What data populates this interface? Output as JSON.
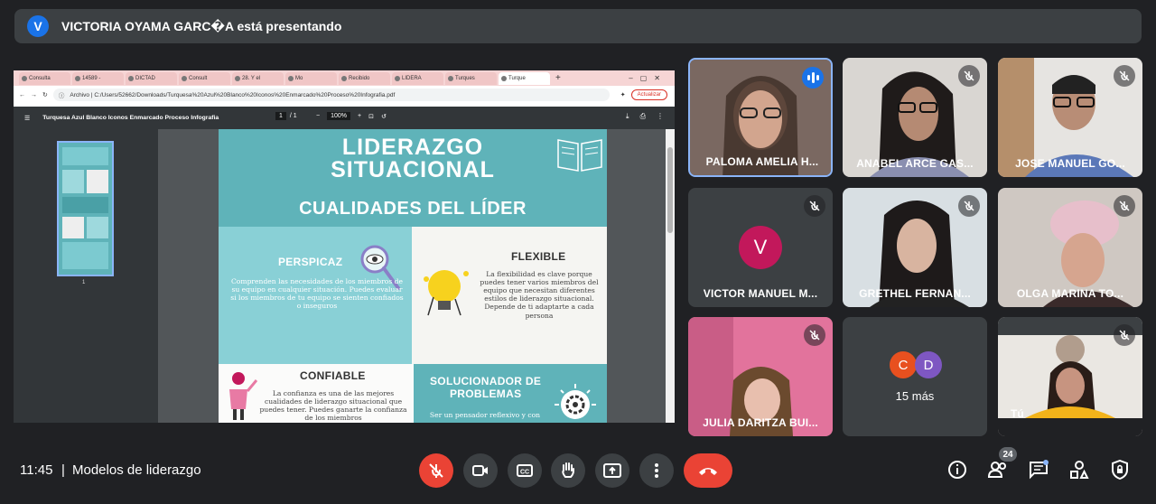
{
  "presenting": {
    "avatar_letter": "V",
    "text": "VICTORIA OYAMA GARC�A está presentando"
  },
  "browser": {
    "tabs": [
      "Consulta",
      "14589 -",
      "DICTAD",
      "Consult",
      "28. Y el",
      "Mo",
      "Recibido",
      "LIDERA",
      "Turques",
      "Turque"
    ],
    "url": "Archivo  |  C:/Users/52662/Downloads/Turquesa%20Azul%20Blanco%20Iconos%20Enmarcado%20Proceso%20Infografia.pdf",
    "update_label": "Actualizar"
  },
  "pdf": {
    "title": "Turquesa Azul Blanco Iconos Enmarcado Proceso Infografia",
    "page_current": "1",
    "page_total": "/ 1",
    "zoom": "100%",
    "thumb_page": "1"
  },
  "infographic": {
    "title_line1": "LIDERAZGO",
    "title_line2": "SITUACIONAL",
    "subtitle": "CUALIDADES DEL LÍDER",
    "perspicaz": {
      "title": "PERSPICAZ",
      "text": "Comprenden las necesidades de los miembros de su equipo en cualquier situación. Puedes evaluar si los miembros de tu equipo se sienten confiados o inseguros"
    },
    "flexible": {
      "title": "FLEXIBLE",
      "text": "La flexibilidad es clave porque puedes tener varios miembros del equipo que necesitan diferentes estilos de liderazgo situacional. Depende de ti adaptarte a cada persona"
    },
    "confiable": {
      "title": "CONFIABLE",
      "text": "La confianza es una de las mejores cualidades de liderazgo situacional que puedes tener. Puedes ganarte la confianza de los miembros"
    },
    "solucionador": {
      "title_line1": "SOLUCIONADOR DE",
      "title_line2": "PROBLEMAS",
      "text": "Ser un pensador reflexivo y con"
    }
  },
  "participants": [
    {
      "name": "PALOMA AMELIA H...",
      "state": "speaking"
    },
    {
      "name": "ANABEL ARCE GAS...",
      "state": "muted"
    },
    {
      "name": "JOSE MANUEL GO...",
      "state": "muted"
    },
    {
      "name": "VICTOR MANUEL M...",
      "state": "muted",
      "avatar_letter": "V",
      "avatar_color": "#c2185b"
    },
    {
      "name": "GRETHEL FERNAN...",
      "state": "muted"
    },
    {
      "name": "OLGA MARINA TO...",
      "state": "muted"
    },
    {
      "name": "JULIA DARITZA BUI...",
      "state": "muted"
    },
    {
      "name": "Tú",
      "state": "muted"
    }
  ],
  "more_tile": {
    "avatars": [
      "C",
      "D"
    ],
    "label": "15 más"
  },
  "bottom": {
    "time": "11:45",
    "separator": "|",
    "meeting_name": "Modelos de liderazgo",
    "people_count": "24"
  },
  "colors": {
    "accent_red": "#ea4335",
    "speaking_blue": "#1a73e8",
    "teal": "#5fb3b9"
  }
}
